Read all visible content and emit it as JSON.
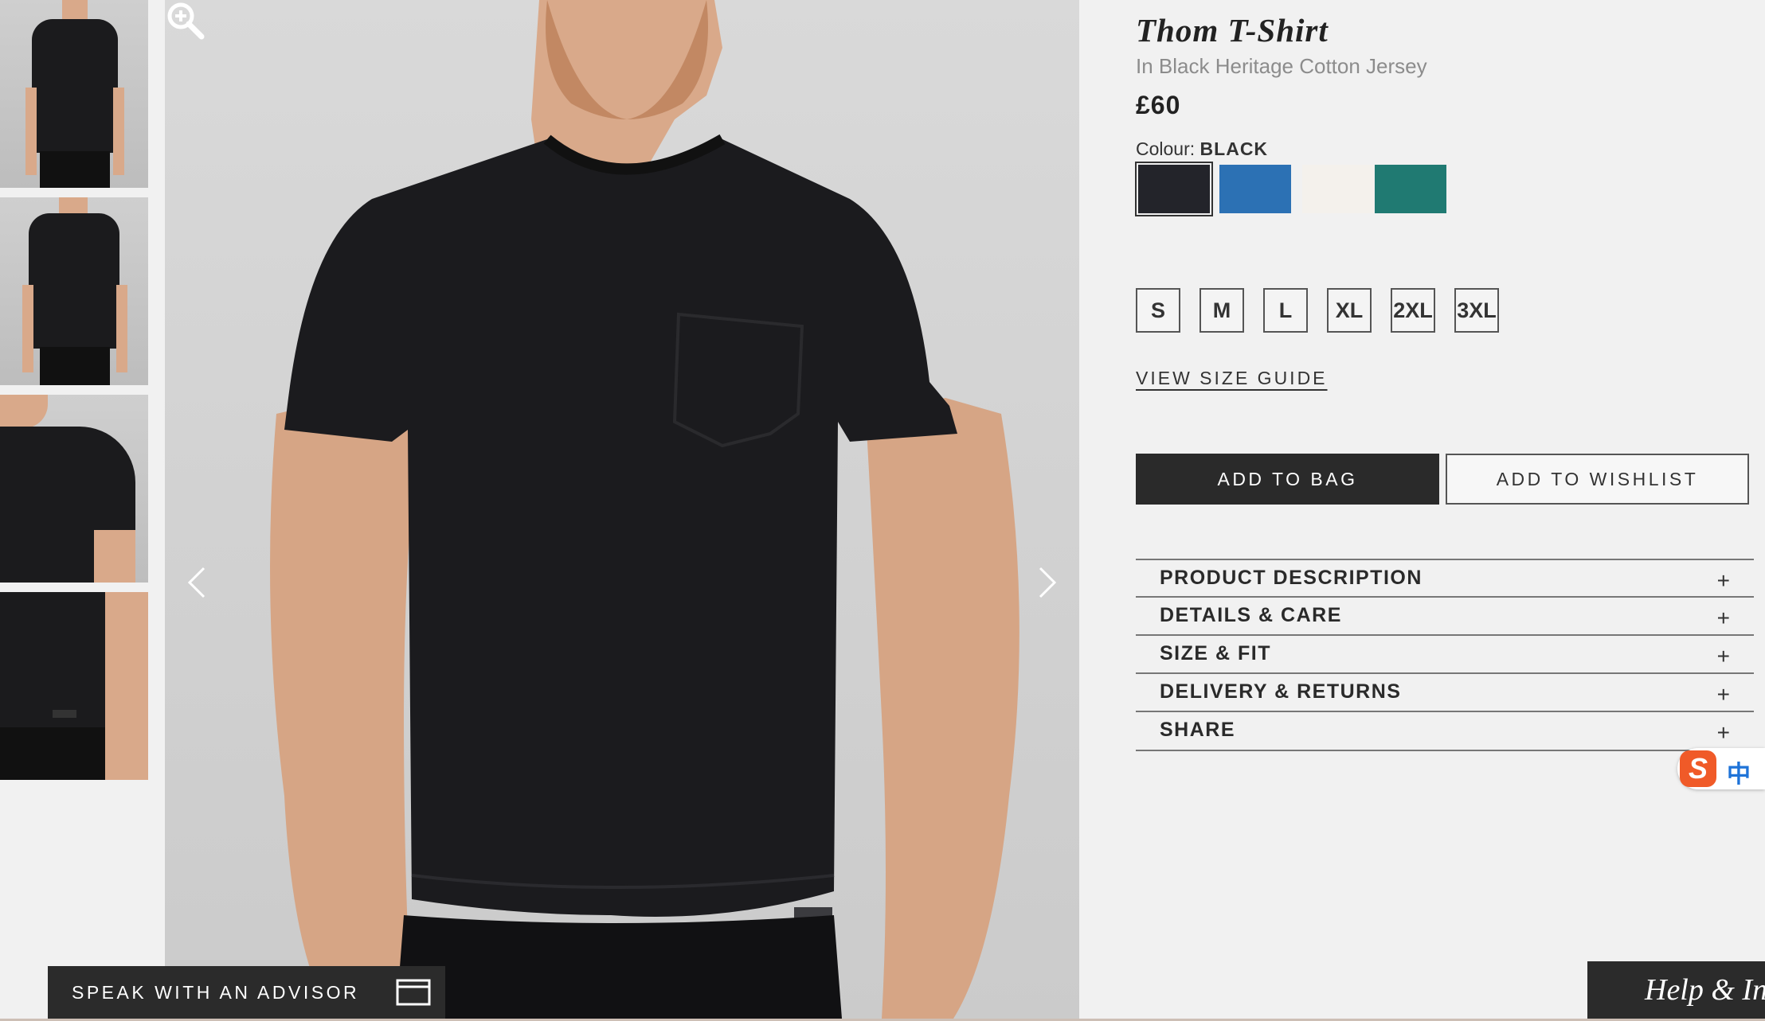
{
  "product": {
    "title": "Thom T-Shirt",
    "subtitle": "In Black Heritage Cotton Jersey",
    "price": "£60"
  },
  "colour": {
    "label": "Colour:",
    "selected": "BLACK",
    "swatches": [
      {
        "name": "black",
        "color": "#23242a"
      },
      {
        "name": "blue",
        "color": "#2c71b4"
      },
      {
        "name": "cream",
        "color": "#f4f1ec"
      },
      {
        "name": "teal",
        "color": "#207a72"
      }
    ]
  },
  "sizes": [
    "S",
    "M",
    "L",
    "XL",
    "2XL",
    "3XL"
  ],
  "size_guide": "VIEW SIZE GUIDE",
  "actions": {
    "add_to_bag": "ADD TO BAG",
    "add_to_wishlist": "ADD TO WISHLIST"
  },
  "accordion": [
    {
      "label": "PRODUCT DESCRIPTION",
      "toggle": "+"
    },
    {
      "label": "DETAILS & CARE",
      "toggle": "+"
    },
    {
      "label": "SIZE & FIT",
      "toggle": "+"
    },
    {
      "label": "DELIVERY & RETURNS",
      "toggle": "+"
    },
    {
      "label": "SHARE",
      "toggle": "+"
    }
  ],
  "advisor": {
    "label": "SPEAK WITH AN ADVISOR",
    "icon": "chat-window-icon"
  },
  "help": {
    "label": "Help & In"
  },
  "ime": {
    "logo": "S",
    "mode": "中"
  },
  "gallery": {
    "icons": [
      "zoom-in-icon",
      "chevron-left-icon",
      "chevron-right-icon"
    ]
  }
}
